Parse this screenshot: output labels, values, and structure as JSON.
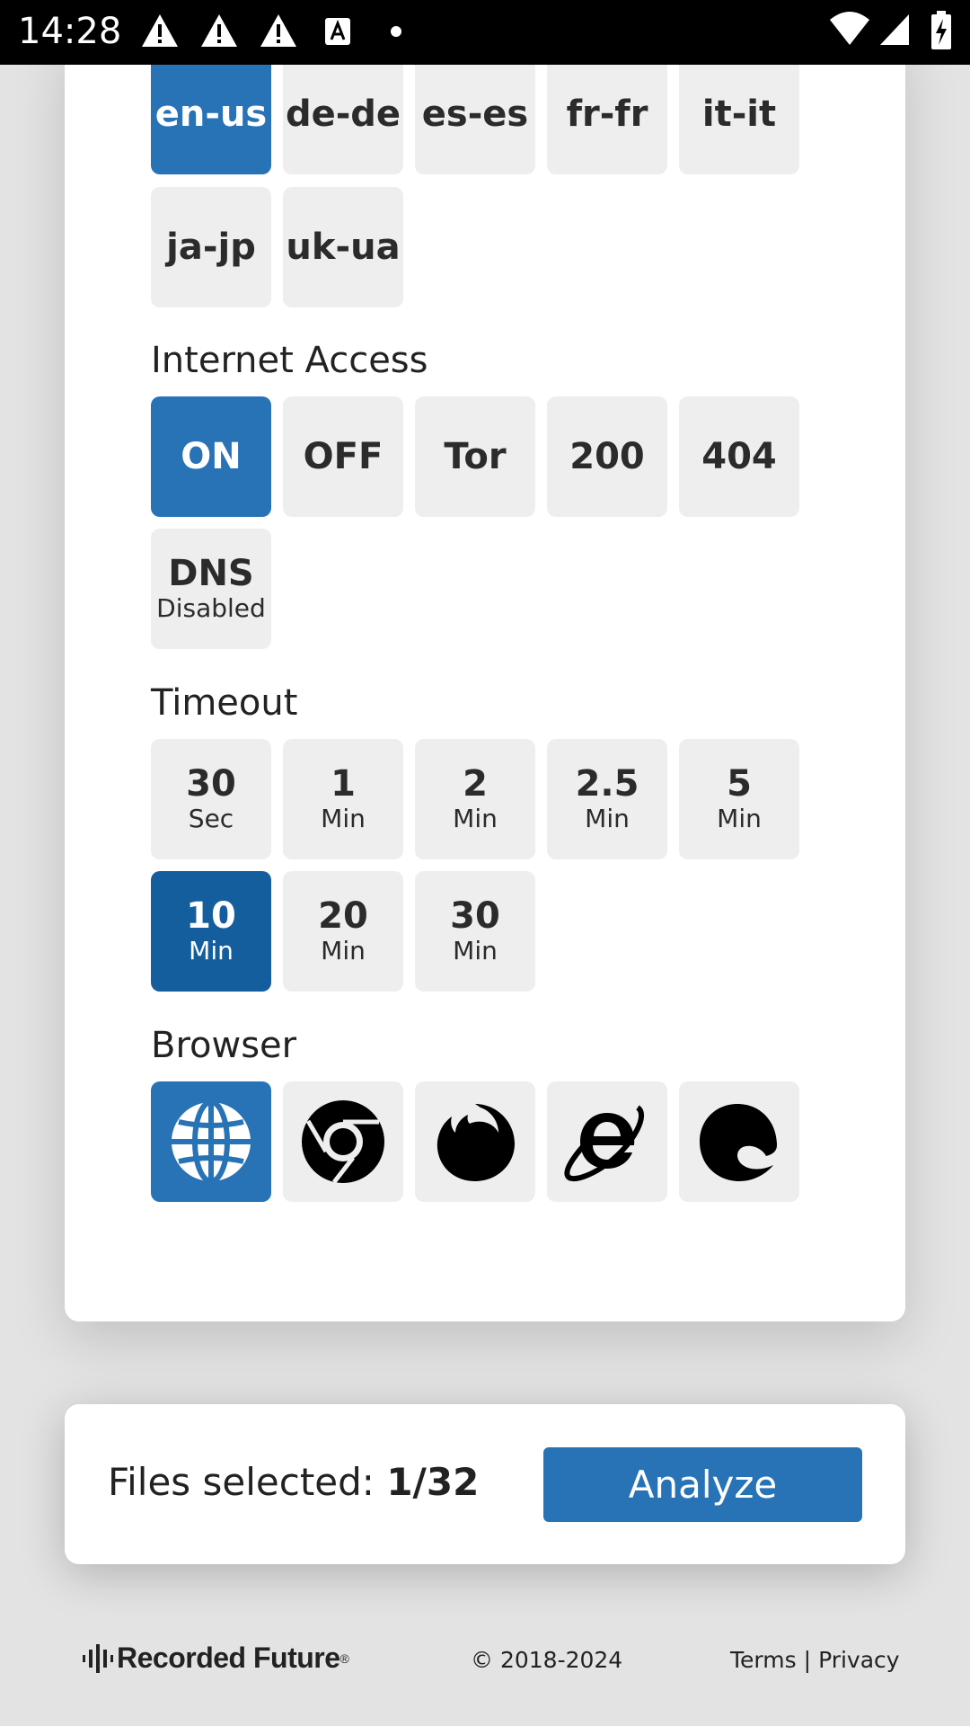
{
  "status_bar": {
    "time": "14:28",
    "icons": [
      "warning-icon",
      "warning-icon",
      "warning-icon",
      "text-icon",
      "dot-icon",
      "wifi-icon",
      "signal-icon",
      "battery-charging-icon"
    ]
  },
  "languages": {
    "options": [
      "en-us",
      "de-de",
      "es-es",
      "fr-fr",
      "it-it",
      "ja-jp",
      "uk-ua"
    ],
    "selected": "en-us"
  },
  "internet_access": {
    "title": "Internet Access",
    "options": [
      "ON",
      "OFF",
      "Tor",
      "200",
      "404"
    ],
    "dns": {
      "label": "DNS",
      "sub": "Disabled"
    },
    "selected": "ON"
  },
  "timeout": {
    "title": "Timeout",
    "options": [
      {
        "value": "30",
        "unit": "Sec"
      },
      {
        "value": "1",
        "unit": "Min"
      },
      {
        "value": "2",
        "unit": "Min"
      },
      {
        "value": "2.5",
        "unit": "Min"
      },
      {
        "value": "5",
        "unit": "Min"
      },
      {
        "value": "10",
        "unit": "Min"
      },
      {
        "value": "20",
        "unit": "Min"
      },
      {
        "value": "30",
        "unit": "Min"
      }
    ],
    "selected": "10 Min"
  },
  "browser": {
    "title": "Browser",
    "options": [
      "globe-icon",
      "chrome-icon",
      "firefox-icon",
      "internet-explorer-icon",
      "edge-icon"
    ],
    "selected": "globe-icon"
  },
  "bottom": {
    "files_label": "Files selected: ",
    "files_count": "1/32",
    "analyze_label": "Analyze"
  },
  "footer": {
    "brand": "Recorded Future",
    "copyright": "© 2018-2024",
    "terms": "Terms",
    "separator": "|",
    "privacy": "Privacy"
  },
  "colors": {
    "accent": "#2872b6",
    "accent_dark": "#155e9e",
    "tile_bg": "#eeeeee"
  }
}
